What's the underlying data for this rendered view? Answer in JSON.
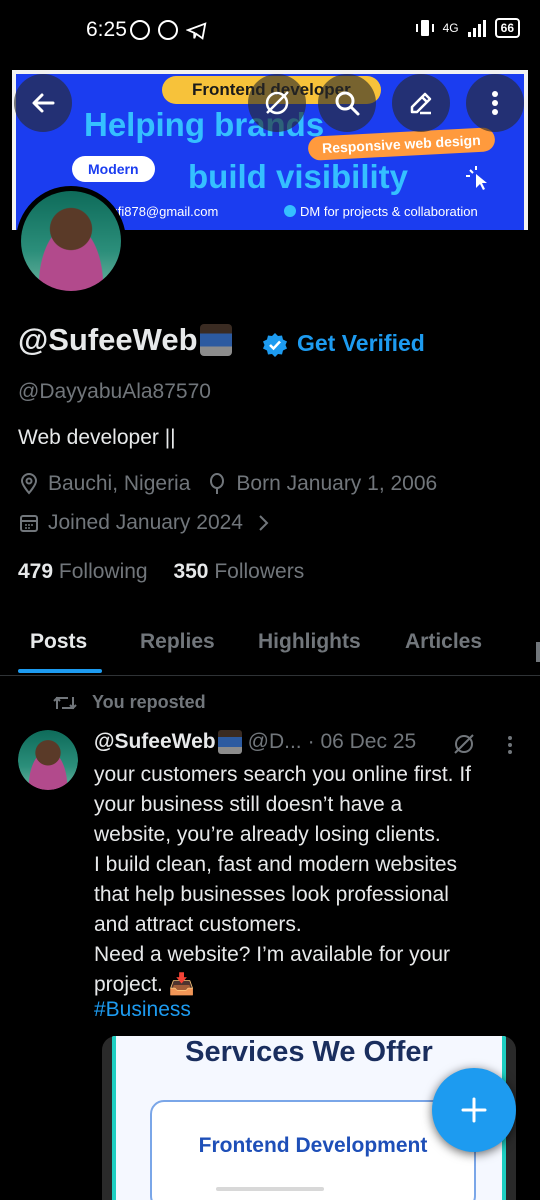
{
  "status_bar": {
    "time": "6:25",
    "network": "4G",
    "battery": "66"
  },
  "banner": {
    "pill_top": "Frontend developer",
    "headline_1": "Helping brands",
    "pill_orange": "Responsive web design",
    "pill_modern": "Modern",
    "headline_2": "build visibility",
    "email": "sufi878@gmail.com",
    "dm": "DM for projects & collaboration"
  },
  "header_buttons": {
    "back": "back-icon",
    "grok": "grok-icon",
    "search": "search-icon",
    "edit": "edit-icon",
    "more": "more-vertical-icon"
  },
  "profile": {
    "display_name": "@SufeeWeb",
    "get_verified": "Get Verified",
    "handle": "@DayyabuAla87570",
    "bio": "Web developer ||",
    "location": "Bauchi, Nigeria",
    "born": "Born January 1, 2006",
    "joined": "Joined January 2024",
    "following_count": "479",
    "following_label": "Following",
    "followers_count": "350",
    "followers_label": "Followers"
  },
  "tabs": [
    {
      "label": "Posts",
      "active": true
    },
    {
      "label": "Replies"
    },
    {
      "label": "Highlights"
    },
    {
      "label": "Articles"
    }
  ],
  "post": {
    "repost_label": "You reposted",
    "author_name": "@SufeeWeb",
    "author_handle": "@D...",
    "date": "· 06 Dec 25",
    "lines": [
      "your customers search you online first. If",
      "your business still doesn’t have a",
      "website, you’re already losing clients.",
      "I build clean, fast and modern websites",
      "that help businesses look professional",
      "and attract customers.",
      "Need a website? I’m available for your",
      "project. 📥"
    ],
    "hashtag": "#Business",
    "media": {
      "title": "Services We Offer",
      "card": "Frontend Development"
    }
  },
  "colors": {
    "accent": "#1d9bf0",
    "muted": "#71767b",
    "text": "#e7e9ea",
    "banner_bg": "#1b3df0"
  }
}
